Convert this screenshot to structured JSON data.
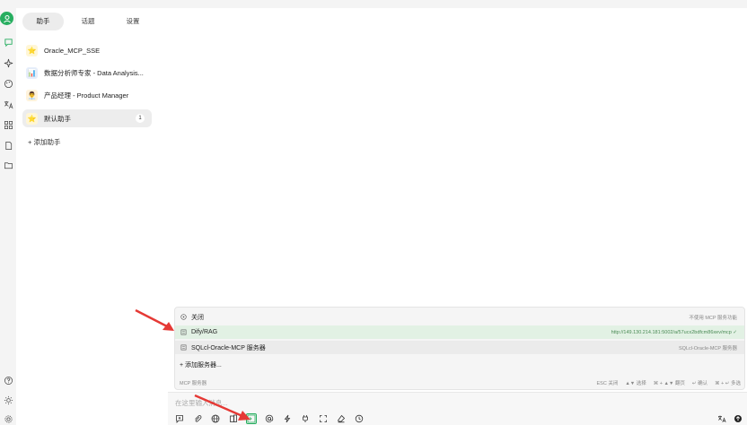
{
  "tabs": [
    "助手",
    "话题",
    "设置"
  ],
  "assistants": [
    {
      "name": "Oracle_MCP_SSE",
      "emoji": "⭐"
    },
    {
      "name": "数据分析师专家 - Data Analysis...",
      "emoji": "📊"
    },
    {
      "name": "产品经理 - Product Manager",
      "emoji": "👨‍💼"
    },
    {
      "name": "默认助手",
      "emoji": "⭐",
      "count": "1"
    }
  ],
  "add_assistant": "+ 添加助手",
  "mcp": {
    "close": {
      "label": "关闭",
      "right": "不使用 MCP 服务功能"
    },
    "servers": [
      {
        "label": "Dify/RAG",
        "right": "http://149.130.214.181:5002/a/57ucx2bdfcm86xev/mcp ✓"
      },
      {
        "label": "SQLcl-Oracle-MCP 服务器",
        "right": "SQLcl-Oracle-MCP 服务器"
      }
    ],
    "add": "+ 添加服务器...",
    "footer_label": "MCP 服务器",
    "hints": [
      "ESC 关闭",
      "▲▼ 选择",
      "⌘ + ▲▼ 翻页",
      "↵ 确认",
      "⌘ + ↵ 多选"
    ]
  },
  "input": {
    "placeholder": "在这里输入消息..."
  },
  "colors": {
    "accent": "#27ae60",
    "highlight": "#e2f1e4",
    "arrow": "#e53935"
  }
}
